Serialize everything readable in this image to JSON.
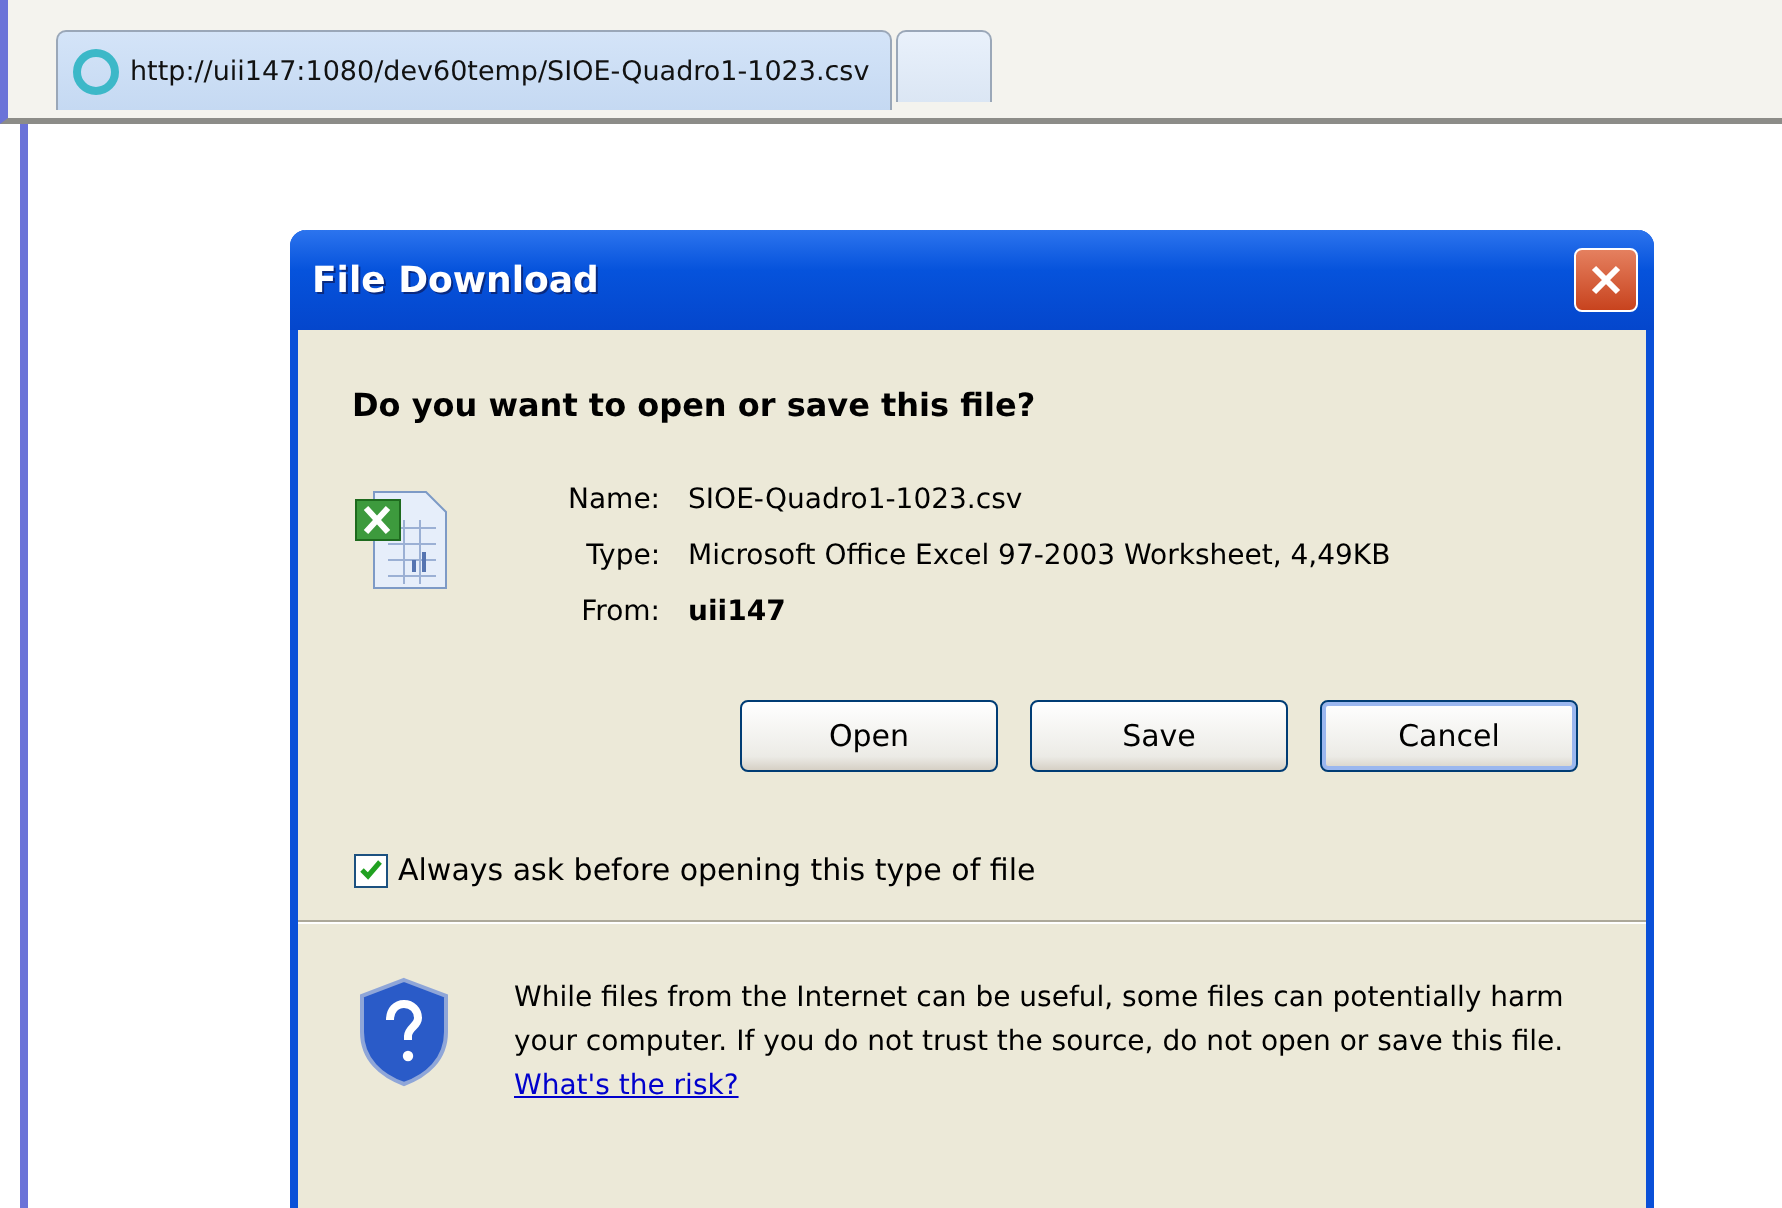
{
  "tabs": [
    {
      "label": "http://uii147:1080/dev60temp/SIOE-Quadro1-1023.csv",
      "selected": true
    },
    {
      "selected": false
    }
  ],
  "dialog": {
    "title": "File Download",
    "question": "Do you want to open or save this file?",
    "fields": [
      {
        "label": "Name:",
        "value": "SIOE-Quadro1-1023.csv",
        "bold": false
      },
      {
        "label": "Type:",
        "value": "Microsoft Office Excel 97-2003 Worksheet, 4,49KB",
        "bold": false
      },
      {
        "label": "From:",
        "value": "uii147",
        "bold": true
      }
    ],
    "buttons": [
      {
        "label": "Open",
        "focused": false
      },
      {
        "label": "Save",
        "focused": false
      },
      {
        "label": "Cancel",
        "focused": true
      }
    ],
    "always_ask": {
      "label": "Always ask before opening this type of file",
      "checked": true
    },
    "warning": {
      "text": "While files from the Internet can be useful, some files can potentially harm your computer. If you do not trust the source, do not open or save this file.",
      "link": "What's the risk?"
    }
  }
}
